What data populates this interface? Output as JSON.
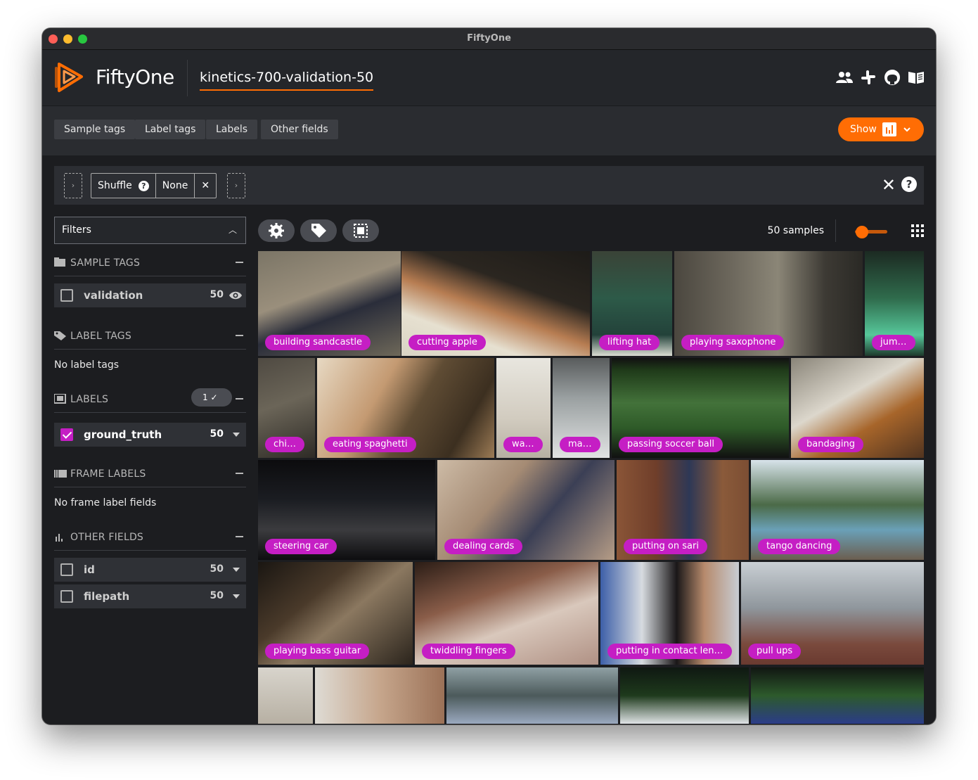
{
  "window": {
    "title": "FiftyOne"
  },
  "header": {
    "brand": "FiftyOne",
    "dataset": "kinetics-700-validation-50",
    "icons": [
      "users-icon",
      "slack-icon",
      "github-icon",
      "docs-icon"
    ]
  },
  "field_tabs": [
    "Sample tags",
    "Label tags",
    "Labels",
    "Other fields"
  ],
  "show_button": {
    "label": "Show"
  },
  "view_bar": {
    "stage": "Shuffle",
    "stage_value": "None",
    "close": "✕",
    "help": "?"
  },
  "sidebar": {
    "filters_label": "Filters",
    "sections": {
      "sample_tags": "SAMPLE TAGS",
      "label_tags": "LABEL TAGS",
      "labels": "LABELS",
      "frame_labels": "FRAME LABELS",
      "other_fields": "OTHER FIELDS"
    },
    "sample_tag_row": {
      "name": "validation",
      "count": "50",
      "checked": false
    },
    "no_label_tags": "No label tags",
    "labels_badge": "1 ✓",
    "label_row": {
      "name": "ground_truth",
      "count": "50",
      "checked": true
    },
    "no_frame_labels": "No frame label fields",
    "other_rows": [
      {
        "name": "id",
        "count": "50",
        "checked": false
      },
      {
        "name": "filepath",
        "count": "50",
        "checked": false
      }
    ]
  },
  "grid": {
    "samples_count": "50 samples",
    "label_color": "#c51ec4",
    "tiles": [
      {
        "label": "building sandcastle"
      },
      {
        "label": "cutting apple"
      },
      {
        "label": "lifting hat"
      },
      {
        "label": "playing saxophone"
      },
      {
        "label": "jum…"
      },
      {
        "label": "chi…"
      },
      {
        "label": "eating spaghetti"
      },
      {
        "label": "wa…"
      },
      {
        "label": "ma…"
      },
      {
        "label": "passing soccer ball"
      },
      {
        "label": "bandaging"
      },
      {
        "label": "steering car"
      },
      {
        "label": "dealing cards"
      },
      {
        "label": "putting on sari"
      },
      {
        "label": "tango dancing"
      },
      {
        "label": "playing bass guitar"
      },
      {
        "label": "twiddling fingers"
      },
      {
        "label": "putting in contact len…"
      },
      {
        "label": "pull ups"
      },
      {
        "label": ""
      },
      {
        "label": ""
      },
      {
        "label": ""
      },
      {
        "label": ""
      },
      {
        "label": ""
      }
    ]
  }
}
